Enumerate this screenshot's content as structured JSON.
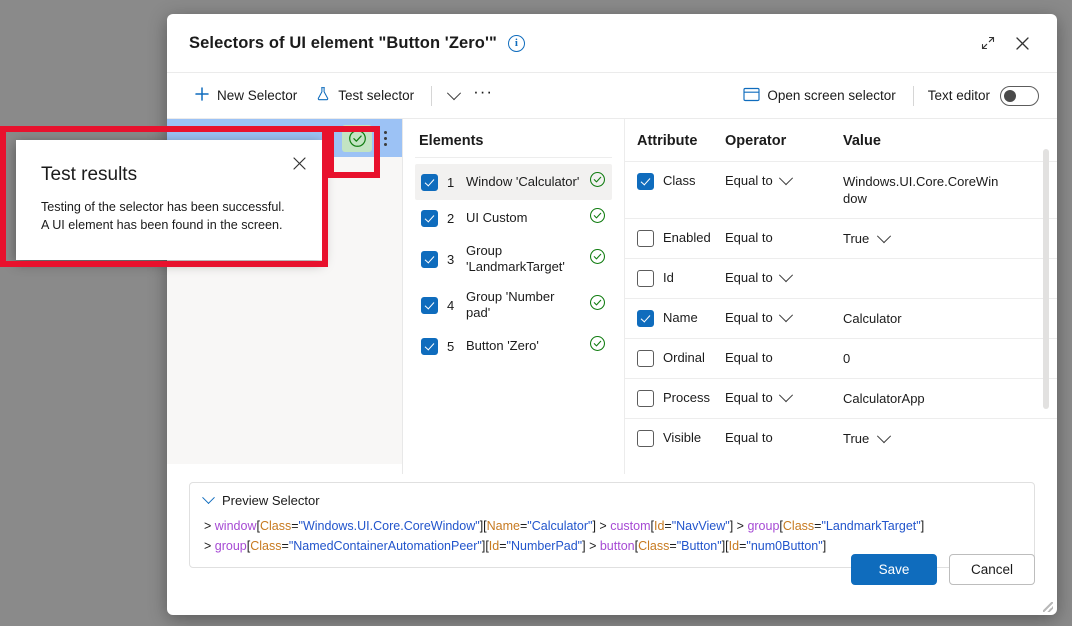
{
  "dialog": {
    "title": "Selectors of UI element \"Button 'Zero'\"",
    "info_icon": "info-icon",
    "expand_icon": "expand-icon",
    "close_icon": "close-icon"
  },
  "toolbar": {
    "new_selector": "New Selector",
    "new_selector_icon": "plus-icon",
    "test_selector": "Test selector",
    "test_selector_icon": "flask-icon",
    "dropdown_icon": "chevron-down-icon",
    "overflow_icon": "ellipsis-icon",
    "open_screen_selector": "Open screen selector",
    "open_screen_selector_icon": "window-icon",
    "text_editor_label": "Text editor",
    "text_editor_toggle": "off"
  },
  "selector_tab": {
    "status_icon": "success-check-icon",
    "more_icon": "vertical-ellipsis-icon"
  },
  "elements": {
    "heading": "Elements",
    "items": [
      {
        "index": "1",
        "label": "Window 'Calculator'",
        "checked": true,
        "status": "success",
        "selected": true
      },
      {
        "index": "2",
        "label": "UI Custom",
        "checked": true,
        "status": "success",
        "selected": false
      },
      {
        "index": "3",
        "label": "Group 'LandmarkTarget'",
        "checked": true,
        "status": "success",
        "selected": false
      },
      {
        "index": "4",
        "label": "Group 'Number pad'",
        "checked": true,
        "status": "success",
        "selected": false
      },
      {
        "index": "5",
        "label": "Button 'Zero'",
        "checked": true,
        "status": "success",
        "selected": false
      }
    ]
  },
  "attributes": {
    "headers": {
      "attribute": "Attribute",
      "operator": "Operator",
      "value": "Value"
    },
    "rows": [
      {
        "name": "Class",
        "checked": true,
        "operator": "Equal to",
        "operator_dropdown": true,
        "value": "Windows.UI.Core.CoreWindow",
        "value_dropdown": false
      },
      {
        "name": "Enabled",
        "checked": false,
        "operator": "Equal to",
        "operator_dropdown": false,
        "value": "True",
        "value_dropdown": true
      },
      {
        "name": "Id",
        "checked": false,
        "operator": "Equal to",
        "operator_dropdown": true,
        "value": "",
        "value_dropdown": false
      },
      {
        "name": "Name",
        "checked": true,
        "operator": "Equal to",
        "operator_dropdown": true,
        "value": "Calculator",
        "value_dropdown": false
      },
      {
        "name": "Ordinal",
        "checked": false,
        "operator": "Equal to",
        "operator_dropdown": false,
        "value": "0",
        "value_dropdown": false
      },
      {
        "name": "Process",
        "checked": false,
        "operator": "Equal to",
        "operator_dropdown": true,
        "value": "CalculatorApp",
        "value_dropdown": false
      },
      {
        "name": "Visible",
        "checked": false,
        "operator": "Equal to",
        "operator_dropdown": false,
        "value": "True",
        "value_dropdown": true
      }
    ]
  },
  "preview": {
    "label": "Preview Selector",
    "expand_icon": "chevron-down-icon",
    "line1": "> window[Class=\"Windows.UI.Core.CoreWindow\"][Name=\"Calculator\"] > custom[Id=\"NavView\"] > group[Class=\"LandmarkTarget\"]",
    "line2": "> group[Class=\"NamedContainerAutomationPeer\"][Id=\"NumberPad\"] > button[Class=\"Button\"][Id=\"num0Button\"]",
    "tokens_line1": [
      {
        "t": "> ",
        "k": "gt"
      },
      {
        "t": "window",
        "k": "el"
      },
      {
        "t": "[",
        "k": "br"
      },
      {
        "t": "Class",
        "k": "at"
      },
      {
        "t": "=",
        "k": "br"
      },
      {
        "t": "\"Windows.UI.Core.CoreWindow\"",
        "k": "val"
      },
      {
        "t": "][",
        "k": "br"
      },
      {
        "t": "Name",
        "k": "at"
      },
      {
        "t": "=",
        "k": "br"
      },
      {
        "t": "\"Calculator\"",
        "k": "val"
      },
      {
        "t": "] ",
        "k": "br"
      },
      {
        "t": "> ",
        "k": "gt"
      },
      {
        "t": "custom",
        "k": "el"
      },
      {
        "t": "[",
        "k": "br"
      },
      {
        "t": "Id",
        "k": "at"
      },
      {
        "t": "=",
        "k": "br"
      },
      {
        "t": "\"NavView\"",
        "k": "val"
      },
      {
        "t": "] ",
        "k": "br"
      },
      {
        "t": "> ",
        "k": "gt"
      },
      {
        "t": "group",
        "k": "el"
      },
      {
        "t": "[",
        "k": "br"
      },
      {
        "t": "Class",
        "k": "at"
      },
      {
        "t": "=",
        "k": "br"
      },
      {
        "t": "\"LandmarkTarget\"",
        "k": "val"
      },
      {
        "t": "]",
        "k": "br"
      }
    ],
    "tokens_line2": [
      {
        "t": "> ",
        "k": "gt"
      },
      {
        "t": "group",
        "k": "el"
      },
      {
        "t": "[",
        "k": "br"
      },
      {
        "t": "Class",
        "k": "at"
      },
      {
        "t": "=",
        "k": "br"
      },
      {
        "t": "\"NamedContainerAutomationPeer\"",
        "k": "val"
      },
      {
        "t": "][",
        "k": "br"
      },
      {
        "t": "Id",
        "k": "at"
      },
      {
        "t": "=",
        "k": "br"
      },
      {
        "t": "\"NumberPad\"",
        "k": "val"
      },
      {
        "t": "] ",
        "k": "br"
      },
      {
        "t": "> ",
        "k": "gt"
      },
      {
        "t": "button",
        "k": "el"
      },
      {
        "t": "[",
        "k": "br"
      },
      {
        "t": "Class",
        "k": "at"
      },
      {
        "t": "=",
        "k": "br"
      },
      {
        "t": "\"Button\"",
        "k": "val"
      },
      {
        "t": "][",
        "k": "br"
      },
      {
        "t": "Id",
        "k": "at"
      },
      {
        "t": "=",
        "k": "br"
      },
      {
        "t": "\"num0Button\"",
        "k": "val"
      },
      {
        "t": "]",
        "k": "br"
      }
    ]
  },
  "footer": {
    "save": "Save",
    "cancel": "Cancel"
  },
  "test_results_popup": {
    "title": "Test results",
    "message": "Testing of the selector has been successful. A UI element has been found in the screen.",
    "close_icon": "close-icon"
  },
  "colors": {
    "accent": "#0f6cbd",
    "success": "#107c10",
    "success_bg": "#c3e4c3",
    "tab_bg": "#9cc2f5",
    "annotation": "#e8112d",
    "backdrop": "#8a8a8a"
  }
}
